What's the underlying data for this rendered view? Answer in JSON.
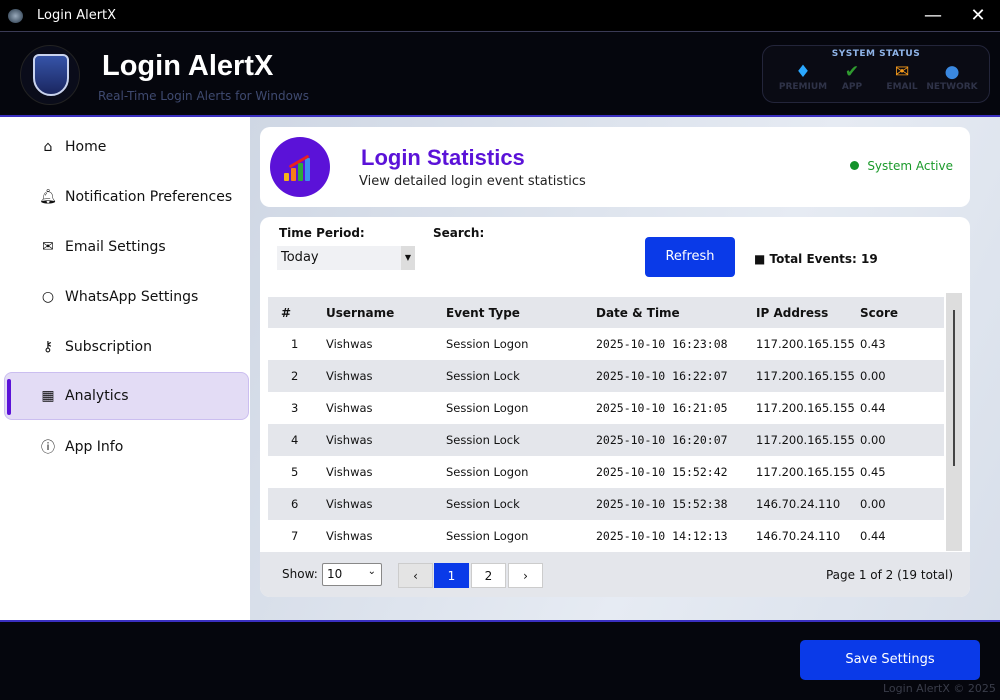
{
  "window": {
    "title": "Login AlertX",
    "minimize": "—",
    "close": "✕"
  },
  "header": {
    "title": "Login AlertX",
    "subtitle": "Real-Time Login Alerts for Windows",
    "status": {
      "title": "SYSTEM STATUS",
      "items": [
        {
          "label": "PREMIUM",
          "icon": "diamond-icon"
        },
        {
          "label": "APP",
          "icon": "check-icon"
        },
        {
          "label": "EMAIL",
          "icon": "email-icon"
        },
        {
          "label": "NETWORK",
          "icon": "globe-icon"
        }
      ]
    }
  },
  "sidebar": {
    "items": [
      {
        "label": "Home",
        "icon": "home-icon"
      },
      {
        "label": "Notification Preferences",
        "icon": "bell-icon"
      },
      {
        "label": "Email Settings",
        "icon": "email-icon"
      },
      {
        "label": "WhatsApp Settings",
        "icon": "chat-icon"
      },
      {
        "label": "Subscription",
        "icon": "key-icon"
      },
      {
        "label": "Analytics",
        "icon": "chart-icon",
        "active": true
      },
      {
        "label": "App Info",
        "icon": "info-icon"
      }
    ]
  },
  "page": {
    "title": "Login Statistics",
    "subtitle": "View detailed login event statistics",
    "status": "System Active"
  },
  "filters": {
    "time_period_label": "Time Period:",
    "time_period_value": "Today",
    "search_label": "Search:",
    "refresh": "Refresh",
    "total_events": "Total Events: 19"
  },
  "table": {
    "headers": [
      "#",
      "Username",
      "Event Type",
      "Date & Time",
      "IP Address",
      "Score"
    ],
    "rows": [
      [
        "1",
        "Vishwas",
        "Session Logon",
        "2025-10-10 16:23:08",
        "117.200.165.155",
        "0.43"
      ],
      [
        "2",
        "Vishwas",
        "Session Lock",
        "2025-10-10 16:22:07",
        "117.200.165.155",
        "0.00"
      ],
      [
        "3",
        "Vishwas",
        "Session Logon",
        "2025-10-10 16:21:05",
        "117.200.165.155",
        "0.44"
      ],
      [
        "4",
        "Vishwas",
        "Session Lock",
        "2025-10-10 16:20:07",
        "117.200.165.155",
        "0.00"
      ],
      [
        "5",
        "Vishwas",
        "Session Logon",
        "2025-10-10 15:52:42",
        "117.200.165.155",
        "0.45"
      ],
      [
        "6",
        "Vishwas",
        "Session Lock",
        "2025-10-10 15:52:38",
        "146.70.24.110",
        "0.00"
      ],
      [
        "7",
        "Vishwas",
        "Session Logon",
        "2025-10-10 14:12:13",
        "146.70.24.110",
        "0.44"
      ]
    ]
  },
  "pagination": {
    "show_label": "Show:",
    "page_size": "10",
    "prev": "‹",
    "pages": [
      "1",
      "2"
    ],
    "next": "›",
    "info": "Page 1 of 2 (19 total)"
  },
  "footer": {
    "save": "Save Settings",
    "copyright": "Login AlertX © 2025"
  }
}
